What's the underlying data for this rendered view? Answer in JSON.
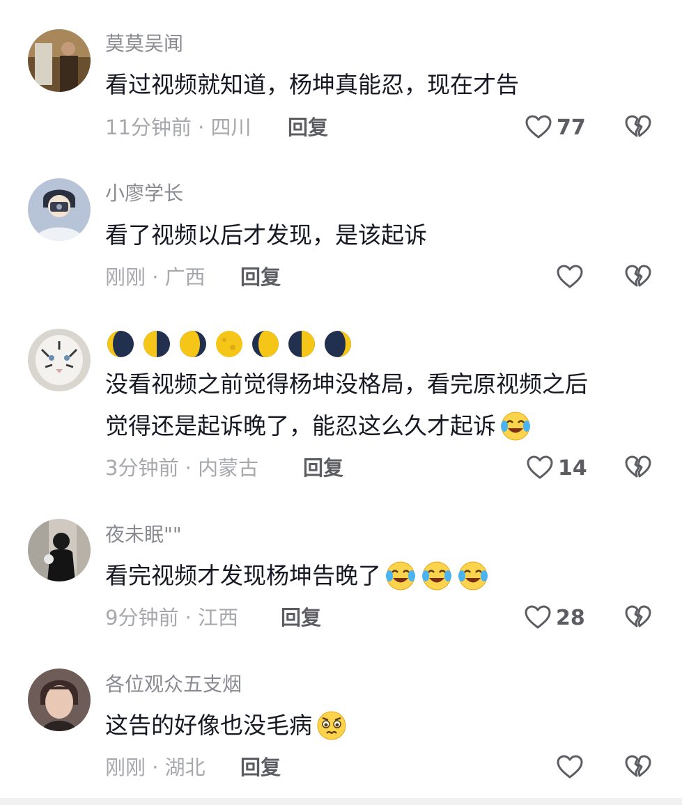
{
  "comments": [
    {
      "username": "莫莫吴闻",
      "text_lines": [
        "看过视频就知道，杨坤真能忍，现在才告"
      ],
      "time_location": "11分钟前 · 四川",
      "reply_label": "回复",
      "like_count": "77"
    },
    {
      "username": "小廖学长",
      "text_lines": [
        "看了视频以后才发现，是该起诉"
      ],
      "time_location": "刚刚 · 广西",
      "reply_label": "回复",
      "like_count": ""
    },
    {
      "username_moons": [
        "waning-crescent",
        "last-quarter",
        "waning-gibbous",
        "full",
        "waxing-gibbous",
        "first-quarter",
        "waxing-crescent"
      ],
      "text_lines": [
        "没看视频之前觉得杨坤没格局，看完原视频之后",
        "觉得还是起诉晚了，能忍这么久才起诉"
      ],
      "time_location": "3分钟前 · 内蒙古",
      "reply_label": "回复",
      "like_count": "14",
      "emoji": "crying-laughing"
    },
    {
      "username": "夜未眠\"\"",
      "text_lines": [
        "看完视频才发现杨坤告晚了"
      ],
      "time_location": "9分钟前 · 江西",
      "reply_label": "回复",
      "like_count": "28",
      "emoji": "crying-laughing",
      "emoji_count": 3
    },
    {
      "username": "各位观众五支烟",
      "text_lines": [
        "这告的好像也没毛病"
      ],
      "time_location": "刚刚 · 湖北",
      "reply_label": "回复",
      "like_count": "",
      "emoji": "pleading-worried"
    }
  ],
  "icons": {
    "like": "heart-icon",
    "dislike": "broken-heart-icon"
  },
  "colors": {
    "username": "#8a8b91",
    "text": "#161823",
    "meta": "#a7a8ad",
    "reply": "#5c5d63",
    "icon_stroke": "#5c5d63",
    "moon_yellow": "#f5c518",
    "moon_dark": "#22304f"
  }
}
